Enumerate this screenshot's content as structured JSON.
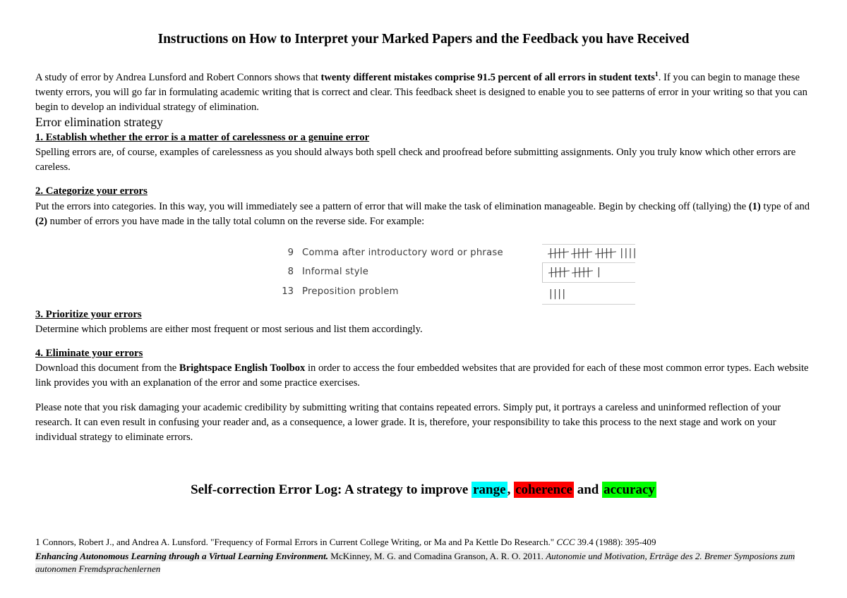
{
  "document": {
    "title": "Instructions on How to Interpret your Marked Papers and the Feedback you have Received",
    "intro": {
      "part1": "A study of error by Andrea Lunsford and Robert Connors shows that ",
      "bold": "twenty different mistakes comprise 91.5 percent of all errors in student texts",
      "superscript": "1",
      "part2": ". If you can begin to manage these twenty errors, you will go far in formulating academic writing that is correct and clear. This feedback sheet is designed to enable you to see patterns of error in your writing so that you can begin to develop an individual strategy of elimination."
    },
    "section_heading": "Error elimination strategy",
    "steps": [
      {
        "heading": "1. Establish whether the error is a matter of carelessness or a genuine error",
        "body": "Spelling errors are, of course, examples of carelessness as you should always both spell check and proofread before submitting assignments. Only you truly know which other errors are careless."
      },
      {
        "heading": "2. Categorize your errors",
        "body_part1": "Put the errors into categories. In this way, you will immediately see a pattern of error that will make the task of elimination manageable. Begin by checking off (tallying) the ",
        "bold1": "(1)",
        "body_part2": " type of and ",
        "bold2": "(2)",
        "body_part3": " number of errors you have made in the tally total column on the reverse side. For example:"
      },
      {
        "heading": "3. Prioritize your errors",
        "body": "Determine which problems are either most frequent or most serious and list them accordingly."
      },
      {
        "heading": "4. Eliminate your errors",
        "body_part1": "Download this document from the ",
        "bold": "Brightspace English Toolbox",
        "body_part2": " in order to access the four embedded websites that are provided for each of these most common error types. Each website link provides you with an explanation of the error and some practice exercises."
      }
    ],
    "closing_paragraph": "Please note that you risk damaging your academic credibility by submitting writing that contains repeated errors. Simply put, it portrays a careless and uninformed reflection of your research. It can even result in confusing your reader and, as a consequence, a lower grade. It is, therefore, your responsibility to take this process to the next stage and work on your individual strategy to eliminate errors.",
    "log_title": {
      "lead": "Self-correction Error Log: A strategy to improve ",
      "highlight_range": "range",
      "comma": ",",
      "space1": " ",
      "highlight_coherence": "coherence",
      "middle": " and ",
      "highlight_accuracy": "accuracy"
    },
    "footnotes": {
      "marker": "1",
      "line1_part1": " Connors, Robert J., and Andrea A. Lunsford. \"Frequency of Formal Errors in Current College Writing, or Ma and Pa Kettle Do Research.\" ",
      "line1_italic": "CCC",
      "line1_part2": " 39.4 (1988): 395-409",
      "line2_bold_italic": "Enhancing Autonomous Learning through a Virtual Learning Environment.",
      "line2_plain": " McKinney, M. G. and Comadina Granson, A. R. O. 2011. ",
      "line2_italic": "Autonomie und Motivation, Erträge des 2. Bremer Symposions zum autonomen Fremdsprachenlernen"
    }
  },
  "tally_figure": {
    "rows": [
      {
        "count": "9",
        "label": "Comma after introductory word or phrase",
        "marks": "|||| |||| |||| ||||",
        "groups": 3,
        "remainder": 4
      },
      {
        "count": "8",
        "label": "Informal style",
        "marks": "|||| |||| |",
        "groups": 2,
        "remainder": 1
      },
      {
        "count": "13",
        "label": "Preposition problem",
        "marks": "||||",
        "groups": 0,
        "remainder": 4
      }
    ]
  },
  "colors": {
    "highlight_range": "#00FFFF",
    "highlight_coherence": "#FF0000",
    "highlight_accuracy": "#00FF00",
    "footnote_highlight": "#EEEEEE",
    "text": "#000000",
    "tally_text": "#3B3B3B"
  }
}
